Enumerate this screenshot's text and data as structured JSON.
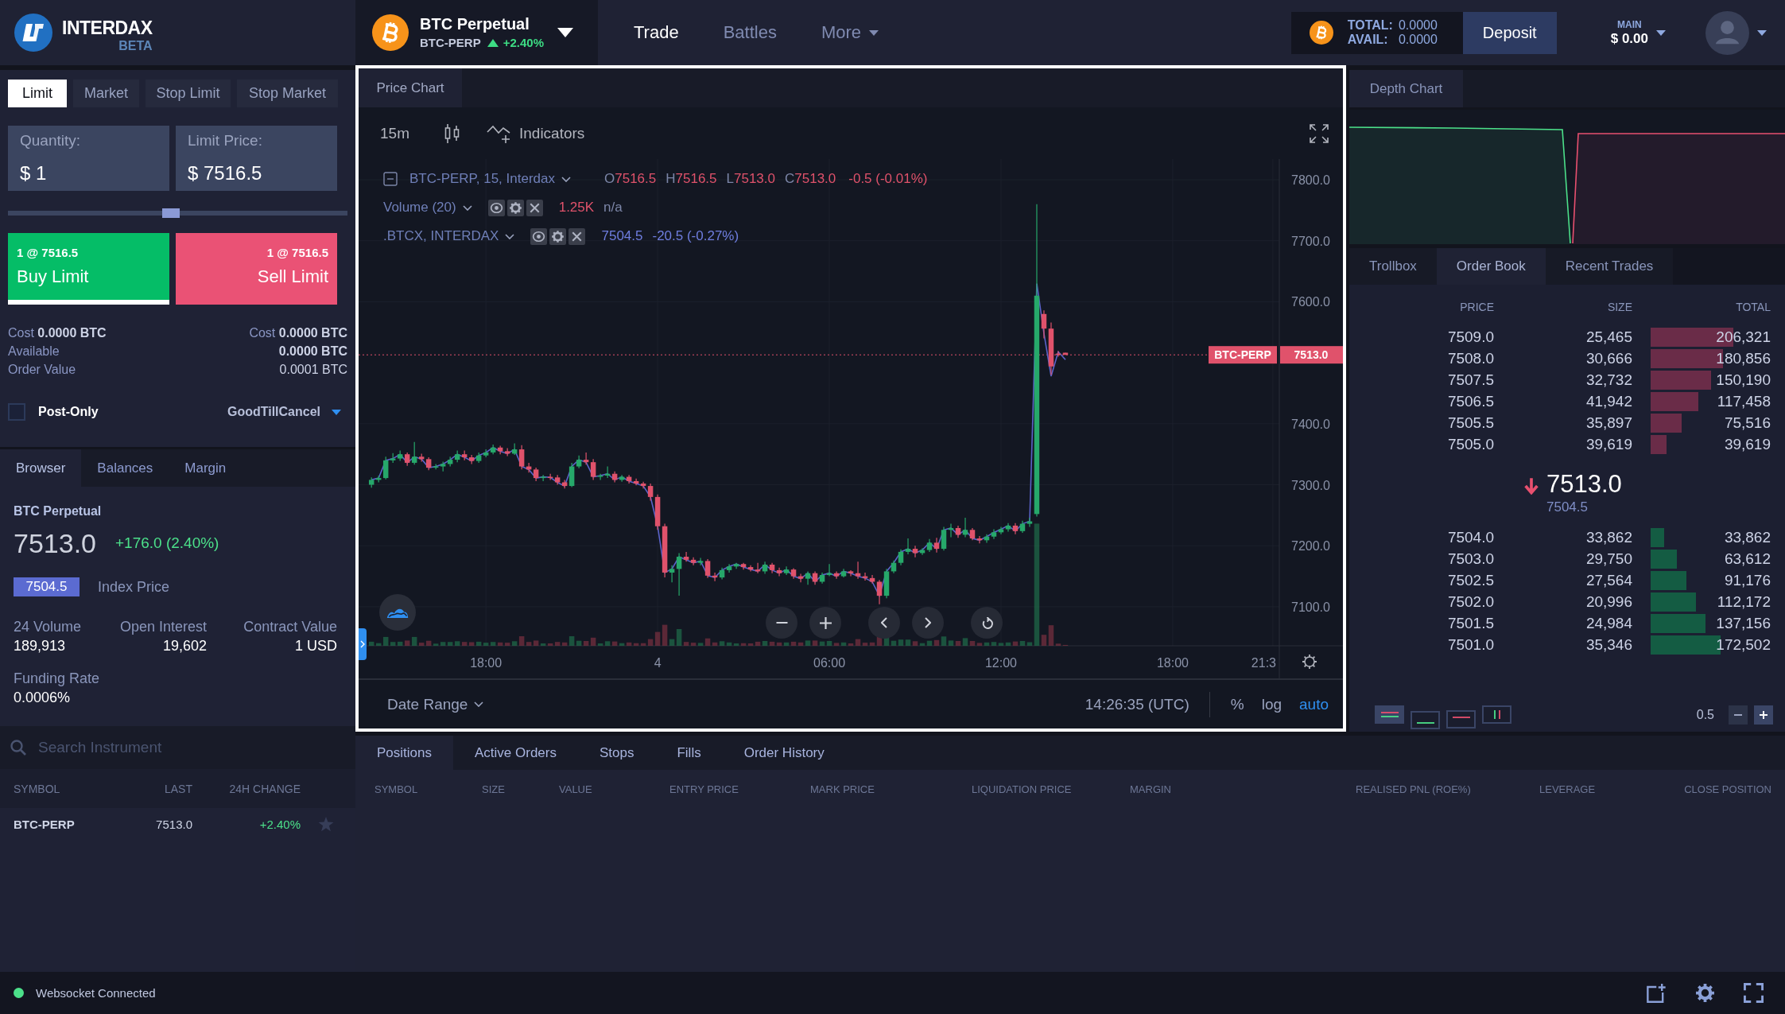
{
  "header": {
    "logo": {
      "name": "INTERDAX",
      "tag": "BETA"
    },
    "instrument": {
      "name": "BTC Perpetual",
      "symbol": "BTC-PERP",
      "rising": true,
      "change": "+2.40%"
    },
    "nav": [
      {
        "label": "Trade",
        "selected": true,
        "has_menu": false
      },
      {
        "label": "Battles",
        "selected": false,
        "has_menu": false
      },
      {
        "label": "More",
        "selected": false,
        "has_menu": true
      }
    ],
    "wallet": {
      "total_label": "TOTAL:",
      "total": "0.0000",
      "avail_label": "AVAIL:",
      "avail": "0.0000"
    },
    "deposit_button": "Deposit",
    "account": {
      "label": "MAIN",
      "balance": "$ 0.00"
    }
  },
  "order_form": {
    "order_types": [
      {
        "label": "Limit",
        "selected": true
      },
      {
        "label": "Market",
        "selected": false
      },
      {
        "label": "Stop Limit",
        "selected": false
      },
      {
        "label": "Stop Market",
        "selected": false
      }
    ],
    "fields": [
      {
        "label": "Quantity:",
        "value": "$ 1"
      },
      {
        "label": "Limit Price:",
        "value": "$ 7516.5"
      }
    ],
    "slider": {
      "level": 0.48
    },
    "sides": [
      {
        "kind": "buy",
        "detail": "1 @ 7516.5",
        "label": "Buy Limit",
        "selected": true
      },
      {
        "kind": "sell",
        "detail": "1 @ 7516.5",
        "label": "Sell Limit",
        "selected": false
      }
    ],
    "costs": [
      {
        "label": "Cost",
        "value": "0.0000 BTC"
      },
      {
        "label": "Cost",
        "value": "0.0000 BTC"
      }
    ],
    "summary": [
      {
        "label": "Available",
        "value": "0.0000 BTC",
        "bold": true
      },
      {
        "label": "Order Value",
        "value": "0.0001 BTC",
        "bold": false
      }
    ],
    "post_only": {
      "label": "Post-Only",
      "checked": false
    },
    "time_in_force": "GoodTillCancel"
  },
  "browser": {
    "tabs": [
      {
        "label": "Browser",
        "selected": true
      },
      {
        "label": "Balances",
        "selected": false
      },
      {
        "label": "Margin",
        "selected": false
      }
    ],
    "instrument": {
      "name": "BTC Perpetual",
      "price": "7513.0",
      "change": "+176.0 (2.40%)",
      "index_price": "7504.5",
      "index_label": "Index Price"
    },
    "stats": [
      {
        "label": "24 Volume",
        "value": "189,913"
      },
      {
        "label": "Open Interest",
        "value": "19,602"
      },
      {
        "label": "Contract Value",
        "value": "1 USD"
      },
      {
        "label": "Funding Rate",
        "value": "0.0006%"
      }
    ],
    "search": {
      "placeholder": "Search Instrument"
    },
    "columns": [
      "SYMBOL",
      "LAST",
      "24H CHANGE"
    ],
    "rows": [
      {
        "symbol": "BTC-PERP",
        "last": "7513.0",
        "change": "+2.40%",
        "starred": false
      }
    ]
  },
  "price_chart": {
    "tab": "Price Chart",
    "interval": "15m",
    "indicators_button": "Indicators",
    "legend": [
      {
        "kind": "main",
        "title": "BTC-PERP, 15, Interdax",
        "ohlc": [
          {
            "key": "O",
            "value": "7516.5"
          },
          {
            "key": "H",
            "value": "7516.5"
          },
          {
            "key": "L",
            "value": "7513.0"
          },
          {
            "key": "C",
            "value": "7513.0"
          }
        ],
        "change": "-0.5 (-0.01%)"
      },
      {
        "kind": "study",
        "title": "Volume (20)",
        "readings": [
          {
            "text": "1.25K",
            "color": "#e0526b"
          },
          {
            "text": "n/a",
            "color": "#7c86a8"
          }
        ]
      },
      {
        "kind": "study",
        "title": ".BTCX, INTERDAX",
        "readings": [
          {
            "text": "7504.5",
            "color": "#6f7ee0"
          },
          {
            "text": "-20.5 (-0.27%)",
            "color": "#6f7ee0"
          }
        ]
      }
    ],
    "last_price_tag": "7513.0",
    "chart_data": [
      {
        "type": "candlestick",
        "categories": [
          null,
          null,
          null,
          null,
          null,
          null,
          null,
          null,
          null,
          null,
          null,
          null,
          null,
          null,
          null,
          null,
          "18:00",
          null,
          null,
          null,
          null,
          null,
          null,
          null,
          null,
          null,
          null,
          null,
          null,
          null,
          null,
          null,
          null,
          null,
          null,
          null,
          null,
          null,
          null,
          null,
          "4",
          null,
          null,
          null,
          null,
          null,
          null,
          null,
          null,
          null,
          null,
          null,
          null,
          null,
          null,
          null,
          null,
          null,
          null,
          null,
          null,
          null,
          null,
          null,
          "06:00",
          null,
          null,
          null,
          null,
          null,
          null,
          null,
          null,
          null,
          null,
          null,
          null,
          null,
          null,
          null,
          null,
          null,
          null,
          null,
          null,
          null,
          null,
          null,
          "12:00",
          null,
          null,
          null,
          null,
          null,
          null,
          null,
          null,
          null,
          null,
          null,
          null,
          null,
          null,
          null,
          null,
          null,
          null,
          null,
          null,
          null,
          null,
          null,
          "18:00",
          null,
          null,
          null,
          null,
          null,
          null,
          null,
          null,
          null,
          null,
          null,
          null,
          null,
          "21:3"
        ],
        "ylim": [
          7036,
          7834
        ],
        "yticks": [
          {
            "value": 7100,
            "label": "7100.0"
          },
          {
            "value": 7200,
            "label": "7200.0"
          },
          {
            "value": 7300,
            "label": "7300.0"
          },
          {
            "value": 7400,
            "label": "7400.0"
          },
          {
            "value": 7600,
            "label": "7600.0"
          },
          {
            "value": 7700,
            "label": "7700.0"
          },
          {
            "value": 7800,
            "label": "7800.0"
          }
        ],
        "grid": true,
        "series": [
          {
            "type": "candlestick",
            "ohlc": [
              [
                7300,
                7312,
                7295,
                7308
              ],
              [
                7308,
                7315,
                7304,
                7311
              ],
              [
                7311,
                7346,
                7309,
                7340
              ],
              [
                7340,
                7352,
                7336,
                7343
              ],
              [
                7343,
                7356,
                7339,
                7350
              ],
              [
                7350,
                7353,
                7331,
                7336
              ],
              [
                7336,
                7370,
                7333,
                7346
              ],
              [
                7346,
                7351,
                7338,
                7342
              ],
              [
                7342,
                7345,
                7324,
                7328
              ],
              [
                7328,
                7334,
                7325,
                7330
              ],
              [
                7330,
                7338,
                7322,
                7334
              ],
              [
                7334,
                7346,
                7330,
                7341
              ],
              [
                7341,
                7356,
                7337,
                7350
              ],
              [
                7350,
                7356,
                7340,
                7345
              ],
              [
                7345,
                7349,
                7334,
                7339
              ],
              [
                7339,
                7353,
                7336,
                7348
              ],
              [
                7348,
                7358,
                7345,
                7353
              ],
              [
                7353,
                7366,
                7350,
                7361
              ],
              [
                7361,
                7364,
                7350,
                7355
              ],
              [
                7355,
                7360,
                7347,
                7351
              ],
              [
                7351,
                7368,
                7349,
                7358
              ],
              [
                7358,
                7365,
                7325,
                7330
              ],
              [
                7330,
                7336,
                7320,
                7325
              ],
              [
                7325,
                7328,
                7306,
                7311
              ],
              [
                7311,
                7316,
                7306,
                7313
              ],
              [
                7313,
                7318,
                7308,
                7312
              ],
              [
                7312,
                7316,
                7300,
                7304
              ],
              [
                7304,
                7308,
                7294,
                7298
              ],
              [
                7298,
                7336,
                7296,
                7330
              ],
              [
                7330,
                7348,
                7327,
                7341
              ],
              [
                7341,
                7353,
                7333,
                7337
              ],
              [
                7337,
                7342,
                7308,
                7313
              ],
              [
                7313,
                7318,
                7308,
                7315
              ],
              [
                7315,
                7330,
                7311,
                7318
              ],
              [
                7318,
                7322,
                7304,
                7308
              ],
              [
                7308,
                7316,
                7305,
                7313
              ],
              [
                7313,
                7316,
                7302,
                7306
              ],
              [
                7306,
                7310,
                7299,
                7302
              ],
              [
                7302,
                7305,
                7294,
                7298
              ],
              [
                7298,
                7302,
                7274,
                7280
              ],
              [
                7280,
                7284,
                7226,
                7232
              ],
              [
                7232,
                7236,
                7148,
                7156
              ],
              [
                7156,
                7168,
                7140,
                7162
              ],
              [
                7162,
                7188,
                7118,
                7182
              ],
              [
                7182,
                7190,
                7174,
                7177
              ],
              [
                7177,
                7181,
                7168,
                7172
              ],
              [
                7172,
                7180,
                7168,
                7175
              ],
              [
                7175,
                7178,
                7147,
                7151
              ],
              [
                7151,
                7156,
                7142,
                7148
              ],
              [
                7148,
                7164,
                7145,
                7160
              ],
              [
                7160,
                7170,
                7156,
                7166
              ],
              [
                7166,
                7172,
                7162,
                7170
              ],
              [
                7170,
                7172,
                7161,
                7165
              ],
              [
                7165,
                7168,
                7158,
                7161
              ],
              [
                7161,
                7172,
                7155,
                7158
              ],
              [
                7158,
                7174,
                7154,
                7169
              ],
              [
                7169,
                7172,
                7155,
                7160
              ],
              [
                7160,
                7164,
                7150,
                7155
              ],
              [
                7155,
                7166,
                7152,
                7161
              ],
              [
                7161,
                7163,
                7146,
                7150
              ],
              [
                7150,
                7154,
                7140,
                7146
              ],
              [
                7146,
                7158,
                7136,
                7155
              ],
              [
                7155,
                7158,
                7136,
                7141
              ],
              [
                7141,
                7156,
                7138,
                7152
              ],
              [
                7152,
                7170,
                7150,
                7155
              ],
              [
                7155,
                7158,
                7146,
                7150
              ],
              [
                7150,
                7162,
                7148,
                7158
              ],
              [
                7158,
                7160,
                7150,
                7155
              ],
              [
                7155,
                7174,
                7146,
                7150
              ],
              [
                7150,
                7156,
                7143,
                7147
              ],
              [
                7147,
                7152,
                7138,
                7141
              ],
              [
                7141,
                7144,
                7104,
                7118
              ],
              [
                7118,
                7162,
                7114,
                7158
              ],
              [
                7158,
                7176,
                7155,
                7172
              ],
              [
                7172,
                7194,
                7168,
                7190
              ],
              [
                7190,
                7212,
                7186,
                7195
              ],
              [
                7195,
                7200,
                7181,
                7188
              ],
              [
                7188,
                7196,
                7185,
                7193
              ],
              [
                7193,
                7211,
                7190,
                7205
              ],
              [
                7205,
                7213,
                7189,
                7195
              ],
              [
                7195,
                7231,
                7192,
                7226
              ],
              [
                7226,
                7236,
                7214,
                7229
              ],
              [
                7229,
                7233,
                7213,
                7218
              ],
              [
                7218,
                7246,
                7214,
                7226
              ],
              [
                7226,
                7229,
                7209,
                7212
              ],
              [
                7212,
                7216,
                7204,
                7209
              ],
              [
                7209,
                7219,
                7205,
                7215
              ],
              [
                7215,
                7227,
                7211,
                7222
              ],
              [
                7222,
                7231,
                7219,
                7227
              ],
              [
                7227,
                7237,
                7223,
                7233
              ],
              [
                7233,
                7237,
                7219,
                7224
              ],
              [
                7224,
                7241,
                7221,
                7236
              ],
              [
                7236,
                7246,
                7231,
                7240
              ],
              [
                7252,
                7760,
                7248,
                7610
              ],
              [
                7580,
                7586,
                7540,
                7556
              ],
              [
                7556,
                7566,
                7480,
                7494
              ],
              [
                7515,
                7519,
                7510,
                7513
              ],
              [
                7516.5,
                7516.5,
                7513,
                7513
              ],
              null,
              null,
              null,
              null,
              null,
              null,
              null,
              null,
              null,
              null,
              null,
              null,
              null,
              null,
              null,
              null,
              null,
              null,
              null,
              null,
              null,
              null,
              null,
              null,
              null,
              null,
              null,
              null,
              null
            ]
          },
          {
            "type": "line",
            "color": "#5b63c9",
            "values": [
              7308,
              7311,
              7340,
              7343,
              7350,
              7336,
              7346,
              7342,
              7328,
              7330,
              7334,
              7341,
              7350,
              7345,
              7339,
              7348,
              7353,
              7361,
              7355,
              7351,
              7358,
              7330,
              7325,
              7311,
              7313,
              7312,
              7304,
              7298,
              7330,
              7341,
              7337,
              7313,
              7315,
              7318,
              7308,
              7313,
              7306,
              7302,
              7298,
              7280,
              7232,
              7156,
              7162,
              7182,
              7177,
              7172,
              7175,
              7151,
              7148,
              7160,
              7166,
              7170,
              7165,
              7161,
              7158,
              7169,
              7160,
              7155,
              7161,
              7150,
              7146,
              7155,
              7141,
              7152,
              7155,
              7150,
              7158,
              7155,
              7150,
              7147,
              7141,
              7118,
              7158,
              7172,
              7190,
              7195,
              7188,
              7193,
              7205,
              7195,
              7226,
              7229,
              7218,
              7226,
              7212,
              7209,
              7215,
              7222,
              7227,
              7233,
              7224,
              7236,
              7240,
              7630,
              7548,
              7478,
              7518,
              7505,
              null,
              null,
              null,
              null,
              null,
              null,
              null,
              null,
              null,
              null,
              null,
              null,
              null,
              null,
              null,
              null,
              null,
              null,
              null,
              null,
              null,
              null,
              null,
              null,
              null,
              null,
              null,
              null,
              null
            ]
          }
        ],
        "ref_lines": [
          {
            "axis": "y",
            "value": 7513,
            "label": "BTC-PERP",
            "color": "#e0526b",
            "line_style": "dotted"
          }
        ]
      }
    ],
    "date_range": "Date Range",
    "clock": "14:26:35 (UTC)",
    "scale_options": [
      {
        "label": "%",
        "selected": false
      },
      {
        "label": "log",
        "selected": false
      },
      {
        "label": "auto",
        "selected": true
      }
    ]
  },
  "depth_chart": {
    "tab": "Depth Chart"
  },
  "order_book": {
    "tabs": [
      {
        "label": "Trollbox",
        "selected": false
      },
      {
        "label": "Order Book",
        "selected": true
      },
      {
        "label": "Recent Trades",
        "selected": false
      }
    ],
    "columns": [
      "PRICE",
      "SIZE",
      "TOTAL"
    ],
    "asks": [
      {
        "price": "7509.0",
        "size": "25,465",
        "total": "206,321",
        "level": 0.69
      },
      {
        "price": "7508.0",
        "size": "30,666",
        "total": "180,856",
        "level": 0.6
      },
      {
        "price": "7507.5",
        "size": "32,732",
        "total": "150,190",
        "level": 0.5
      },
      {
        "price": "7506.5",
        "size": "41,942",
        "total": "117,458",
        "level": 0.4
      },
      {
        "price": "7505.5",
        "size": "35,897",
        "total": "75,516",
        "level": 0.26
      },
      {
        "price": "7505.0",
        "size": "39,619",
        "total": "39,619",
        "level": 0.13
      }
    ],
    "last_price": "7513.0",
    "rising": false,
    "index_price": "7504.5",
    "bids": [
      {
        "price": "7504.0",
        "size": "33,862",
        "total": "33,862",
        "level": 0.11
      },
      {
        "price": "7503.0",
        "size": "29,750",
        "total": "63,612",
        "level": 0.22
      },
      {
        "price": "7502.5",
        "size": "27,564",
        "total": "91,176",
        "level": 0.3
      },
      {
        "price": "7502.0",
        "size": "20,996",
        "total": "112,172",
        "level": 0.38
      },
      {
        "price": "7501.5",
        "size": "24,984",
        "total": "137,156",
        "level": 0.46
      },
      {
        "price": "7501.0",
        "size": "35,346",
        "total": "172,502",
        "level": 0.58
      }
    ],
    "views": [
      {
        "kind": "both",
        "selected": true
      },
      {
        "kind": "bids",
        "selected": false
      },
      {
        "kind": "asks",
        "selected": false
      },
      {
        "kind": "bars",
        "selected": false
      }
    ],
    "grouping": "0.5"
  },
  "positions": {
    "tabs": [
      {
        "label": "Positions",
        "selected": true
      },
      {
        "label": "Active Orders",
        "selected": false
      },
      {
        "label": "Stops",
        "selected": false
      },
      {
        "label": "Fills",
        "selected": false
      },
      {
        "label": "Order History",
        "selected": false
      }
    ],
    "columns": [
      "SYMBOL",
      "SIZE",
      "VALUE",
      "ENTRY PRICE",
      "MARK PRICE",
      "LIQUIDATION PRICE",
      "MARGIN",
      "REALISED PNL (ROE%)",
      "LEVERAGE",
      "CLOSE POSITION"
    ]
  },
  "status_bar": {
    "connected": true,
    "message": "Websocket Connected"
  }
}
